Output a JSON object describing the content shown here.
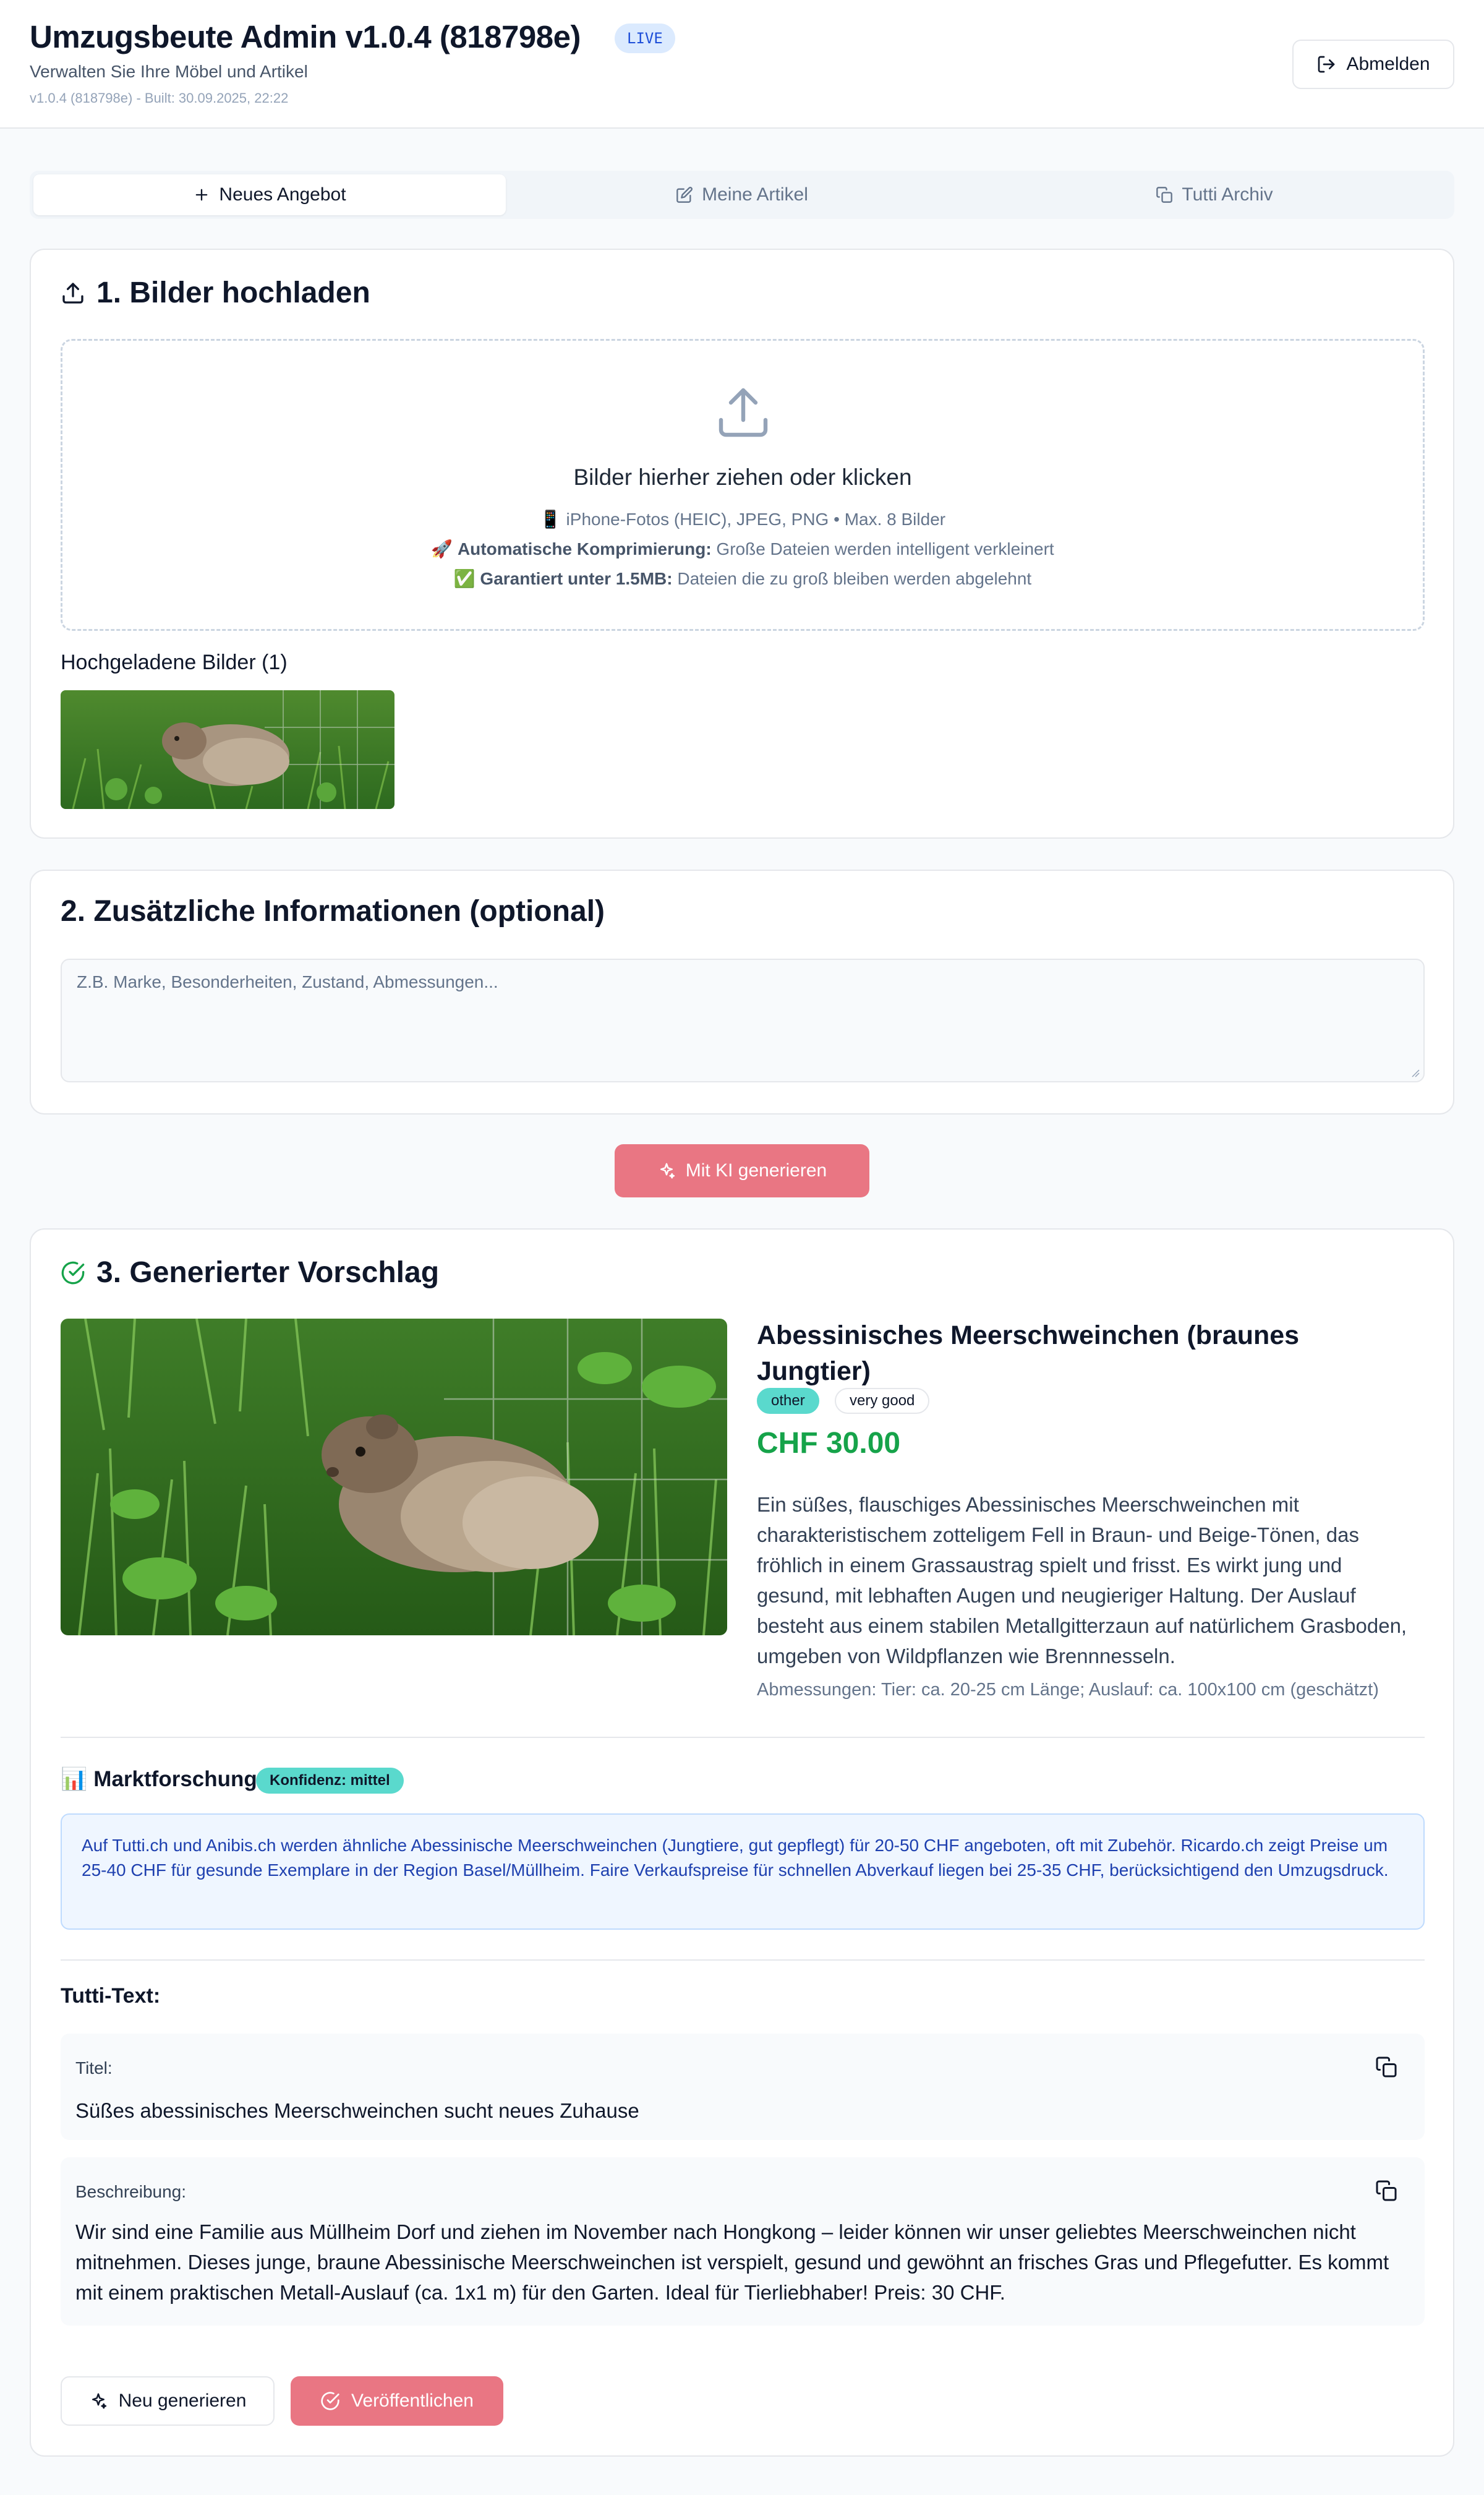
{
  "header": {
    "title": "Umzugsbeute Admin v1.0.4 (818798e)",
    "badge": "LIVE",
    "subtitle": "Verwalten Sie Ihre Möbel und Artikel",
    "version": "v1.0.4 (818798e) - Built: 30.09.2025, 22:22",
    "logout_label": "Abmelden"
  },
  "tabs": [
    {
      "label": "Neues Angebot",
      "icon": "plus-icon",
      "active": true
    },
    {
      "label": "Meine Artikel",
      "icon": "edit-icon",
      "active": false
    },
    {
      "label": "Tutti Archiv",
      "icon": "copy-icon",
      "active": false
    }
  ],
  "upload": {
    "title": "1. Bilder hochladen",
    "dropzone_main": "Bilder hierher ziehen oder klicken",
    "line1": "📱 iPhone-Fotos (HEIC), JPEG, PNG • Max. 8 Bilder",
    "line2_prefix": "🚀 ",
    "line2_bold": "Automatische Komprimierung:",
    "line2_rest": " Große Dateien werden intelligent verkleinert",
    "line3_prefix": "✅ ",
    "line3_bold": "Garantiert unter 1.5MB:",
    "line3_rest": " Dateien die zu groß bleiben werden abgelehnt",
    "uploaded_label": "Hochgeladene Bilder (1)"
  },
  "info": {
    "title": "2. Zusätzliche Informationen (optional)",
    "placeholder": "Z.B. Marke, Besonderheiten, Zustand, Abmessungen..."
  },
  "generate_label": "Mit KI generieren",
  "result": {
    "title": "3. Generierter Vorschlag",
    "product_title": "Abessinisches Meerschweinchen (braunes Jungtier)",
    "category": "other",
    "condition": "very good",
    "price": "CHF 30.00",
    "description": "Ein süßes, flauschiges Abessinisches Meerschweinchen mit charakteristischem zotteligem Fell in Braun- und Beige-Tönen, das fröhlich in einem Grassaustrag spielt und frisst. Es wirkt jung und gesund, mit lebhaften Augen und neugieriger Haltung. Der Auslauf besteht aus einem stabilen Metallgitterzaun auf natürlichem Grasboden, umgeben von Wildpflanzen wie Brennnesseln.",
    "dimensions": "Abmessungen: Tier: ca. 20-25 cm Länge; Auslauf: ca. 100x100 cm (geschätzt)",
    "market_title": "📊 Marktforschung",
    "confidence": "Konfidenz: mittel",
    "market_text": "Auf Tutti.ch und Anibis.ch werden ähnliche Abessinische Meerschweinchen (Jungtiere, gut gepflegt) für 20-50 CHF angeboten, oft mit Zubehör. Ricardo.ch zeigt Preise um 25-40 CHF für gesunde Exemplare in der Region Basel/Müllheim. Faire Verkaufspreise für schnellen Abverkauf liegen bei 25-35 CHF, berücksichtigend den Umzugsdruck.",
    "tutti_label": "Tutti-Text:",
    "title_label": "Titel:",
    "tutti_title": "Süßes abessinisches Meerschweinchen sucht neues Zuhause",
    "desc_label": "Beschreibung:",
    "tutti_description": "Wir sind eine Familie aus Müllheim Dorf und ziehen im November nach Hongkong – leider können wir unser geliebtes Meerschweinchen nicht mitnehmen. Dieses junge, braune Abessinische Meerschweinchen ist verspielt, gesund und gewöhnt an frisches Gras und Pflegefutter. Es kommt mit einem praktischen Metall-Auslauf (ca. 1x1 m) für den Garten. Ideal für Tierliebhaber! Preis: 30 CHF.",
    "regen_label": "Neu generieren",
    "publish_label": "Veröffentlichen"
  },
  "colors": {
    "accent": "#e97683",
    "price": "#16a34a",
    "chip": "#5ad9cd"
  }
}
